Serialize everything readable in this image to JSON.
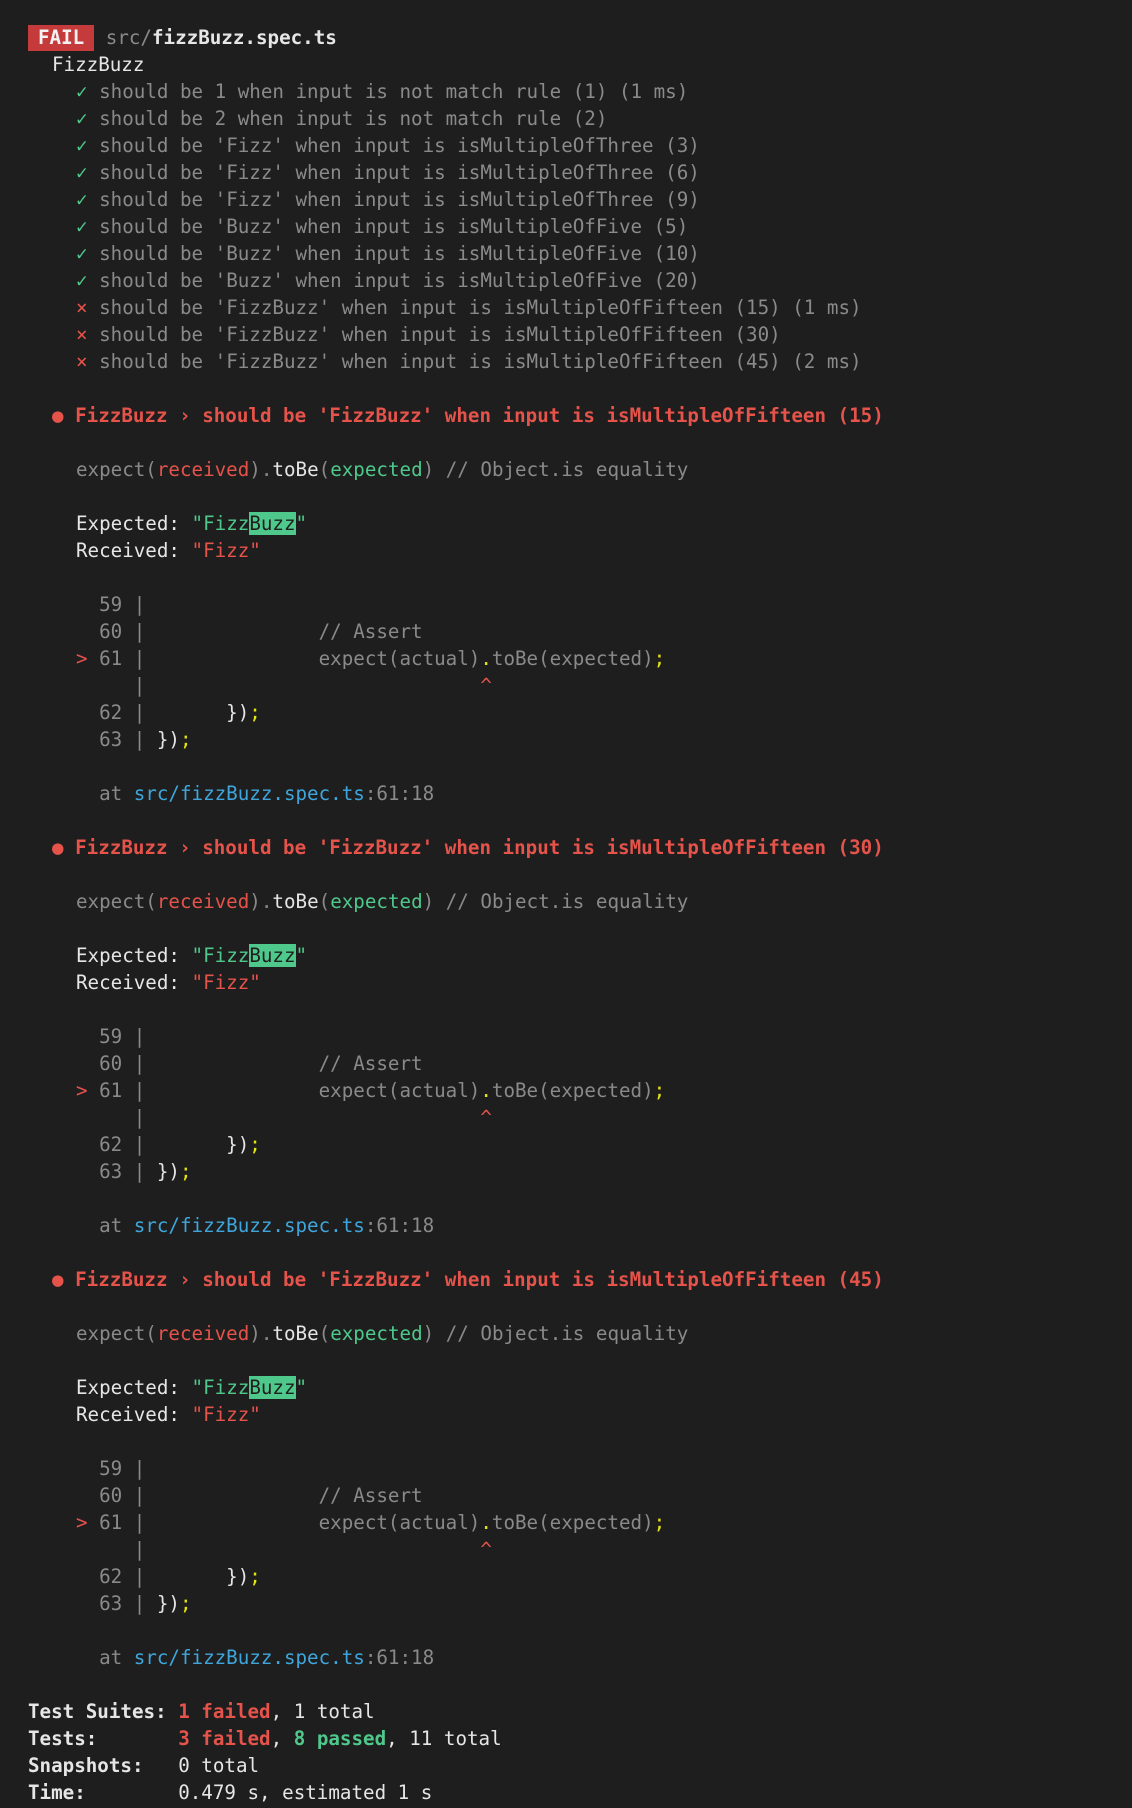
{
  "header": {
    "status_badge": "FAIL",
    "file_dir": "src/",
    "file_name": "fizzBuzz.spec.ts"
  },
  "suite": {
    "name": "FizzBuzz",
    "tests": [
      {
        "status": "pass",
        "icon": "✓",
        "title": "should be 1 when input is not match rule (1) (1 ms)"
      },
      {
        "status": "pass",
        "icon": "✓",
        "title": "should be 2 when input is not match rule (2)"
      },
      {
        "status": "pass",
        "icon": "✓",
        "title": "should be 'Fizz' when input is isMultipleOfThree (3)"
      },
      {
        "status": "pass",
        "icon": "✓",
        "title": "should be 'Fizz' when input is isMultipleOfThree (6)"
      },
      {
        "status": "pass",
        "icon": "✓",
        "title": "should be 'Fizz' when input is isMultipleOfThree (9)"
      },
      {
        "status": "pass",
        "icon": "✓",
        "title": "should be 'Buzz' when input is isMultipleOfFive (5)"
      },
      {
        "status": "pass",
        "icon": "✓",
        "title": "should be 'Buzz' when input is isMultipleOfFive (10)"
      },
      {
        "status": "pass",
        "icon": "✓",
        "title": "should be 'Buzz' when input is isMultipleOfFive (20)"
      },
      {
        "status": "fail",
        "icon": "×",
        "title": "should be 'FizzBuzz' when input is isMultipleOfFifteen (15) (1 ms)"
      },
      {
        "status": "fail",
        "icon": "×",
        "title": "should be 'FizzBuzz' when input is isMultipleOfFifteen (30)"
      },
      {
        "status": "fail",
        "icon": "×",
        "title": "should be 'FizzBuzz' when input is isMultipleOfFifteen (45) (2 ms)"
      }
    ]
  },
  "failures": [
    {
      "bullet": "●",
      "title": "FizzBuzz › should be 'FizzBuzz' when input is isMultipleOfFifteen (15)",
      "matcher": {
        "p1": "expect(",
        "received": "received",
        "p2": ")",
        "dot": ".",
        "method": "toBe",
        "p3": "(",
        "expected": "expected",
        "p4": ")",
        "comment": " // Object.is equality"
      },
      "expected_label": "Expected: ",
      "expected_common": "Fizz",
      "expected_diff": "Buzz",
      "received_label": "Received: ",
      "received_value": "\"Fizz\"",
      "code": {
        "l59": "  59 |",
        "l60_num": "  60 |",
        "l60_code": "               // Assert",
        "l61_marker": "> ",
        "l61_num": "61 |",
        "l61_code_a": "               expect(actual)",
        "l61_dot": ".",
        "l61_code_b": "toBe(expected)",
        "l61_semi": ";",
        "caret_bar": "     |",
        "caret": "                             ^",
        "l62_num": "  62 |",
        "l62_code": "       })",
        "l63_num": "  63 |",
        "l63_code": " })",
        "semi": ";"
      },
      "at_prefix": "  at ",
      "at_path": "src/fizzBuzz.spec.ts",
      "at_pos": ":61:18"
    },
    {
      "bullet": "●",
      "title": "FizzBuzz › should be 'FizzBuzz' when input is isMultipleOfFifteen (30)",
      "matcher": {
        "p1": "expect(",
        "received": "received",
        "p2": ")",
        "dot": ".",
        "method": "toBe",
        "p3": "(",
        "expected": "expected",
        "p4": ")",
        "comment": " // Object.is equality"
      },
      "expected_label": "Expected: ",
      "expected_common": "Fizz",
      "expected_diff": "Buzz",
      "received_label": "Received: ",
      "received_value": "\"Fizz\"",
      "code": {
        "l59": "  59 |",
        "l60_num": "  60 |",
        "l60_code": "               // Assert",
        "l61_marker": "> ",
        "l61_num": "61 |",
        "l61_code_a": "               expect(actual)",
        "l61_dot": ".",
        "l61_code_b": "toBe(expected)",
        "l61_semi": ";",
        "caret_bar": "     |",
        "caret": "                             ^",
        "l62_num": "  62 |",
        "l62_code": "       })",
        "l63_num": "  63 |",
        "l63_code": " })",
        "semi": ";"
      },
      "at_prefix": "  at ",
      "at_path": "src/fizzBuzz.spec.ts",
      "at_pos": ":61:18"
    },
    {
      "bullet": "●",
      "title": "FizzBuzz › should be 'FizzBuzz' when input is isMultipleOfFifteen (45)",
      "matcher": {
        "p1": "expect(",
        "received": "received",
        "p2": ")",
        "dot": ".",
        "method": "toBe",
        "p3": "(",
        "expected": "expected",
        "p4": ")",
        "comment": " // Object.is equality"
      },
      "expected_label": "Expected: ",
      "expected_common": "Fizz",
      "expected_diff": "Buzz",
      "received_label": "Received: ",
      "received_value": "\"Fizz\"",
      "code": {
        "l59": "  59 |",
        "l60_num": "  60 |",
        "l60_code": "               // Assert",
        "l61_marker": "> ",
        "l61_num": "61 |",
        "l61_code_a": "               expect(actual)",
        "l61_dot": ".",
        "l61_code_b": "toBe(expected)",
        "l61_semi": ";",
        "caret_bar": "     |",
        "caret": "                             ^",
        "l62_num": "  62 |",
        "l62_code": "       })",
        "l63_num": "  63 |",
        "l63_code": " })",
        "semi": ";"
      },
      "at_prefix": "  at ",
      "at_path": "src/fizzBuzz.spec.ts",
      "at_pos": ":61:18"
    }
  ],
  "summary": {
    "suites_label": "Test Suites: ",
    "suites_failed": "1 failed",
    "suites_total": ", 1 total",
    "tests_label": "Tests:       ",
    "tests_failed": "3 failed",
    "tests_sep": ", ",
    "tests_passed": "8 passed",
    "tests_total": ", 11 total",
    "snapshots_label": "Snapshots:   ",
    "snapshots_value": "0 total",
    "time_label": "Time:        ",
    "time_value": "0.479 s, estimated 1 s"
  },
  "colors": {
    "background": "#1e1e1e",
    "fail": "#e5534b",
    "pass": "#4ec98b",
    "link": "#3ea6dc",
    "badge": "#c53b3b"
  }
}
